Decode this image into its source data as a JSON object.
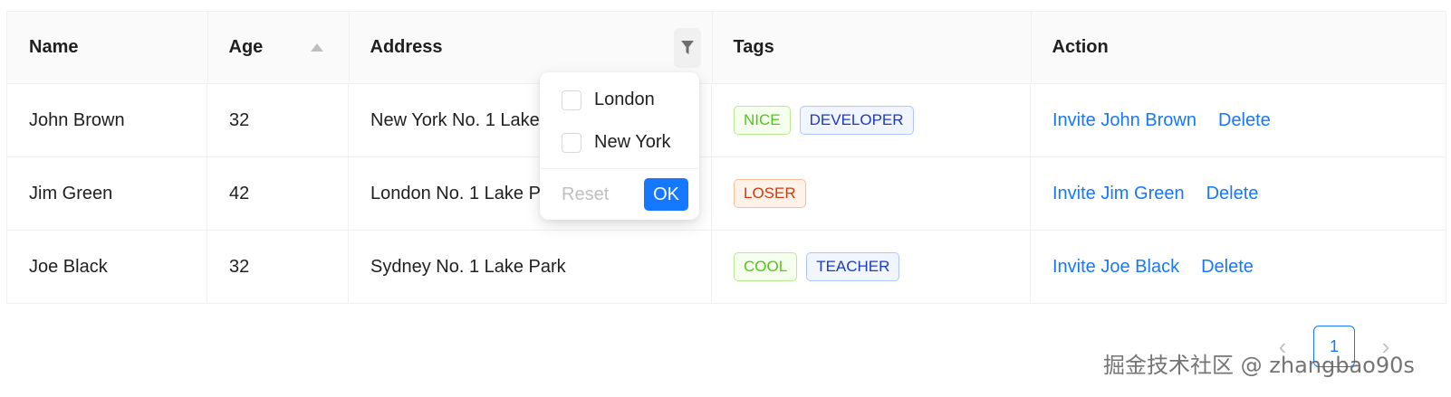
{
  "table": {
    "columns": {
      "name": "Name",
      "age": "Age",
      "address": "Address",
      "tags": "Tags",
      "action": "Action"
    },
    "rows": [
      {
        "name": "John Brown",
        "age": "32",
        "address": "New York No. 1 Lake Park",
        "tags": [
          "NICE",
          "DEVELOPER"
        ],
        "invite": "Invite John Brown",
        "delete": "Delete"
      },
      {
        "name": "Jim Green",
        "age": "42",
        "address": "London No. 1 Lake Park",
        "tags": [
          "LOSER"
        ],
        "invite": "Invite Jim Green",
        "delete": "Delete"
      },
      {
        "name": "Joe Black",
        "age": "32",
        "address": "Sydney No. 1 Lake Park",
        "tags": [
          "COOL",
          "TEACHER"
        ],
        "invite": "Invite Joe Black",
        "delete": "Delete"
      }
    ]
  },
  "filter_dropdown": {
    "options": [
      "London",
      "New York"
    ],
    "reset_label": "Reset",
    "ok_label": "OK"
  },
  "pagination": {
    "current_page": "1",
    "prev_icon": "chevron-left-icon",
    "next_icon": "chevron-right-icon"
  },
  "watermark": "掘金技术社区 @ zhangbao90s",
  "colors": {
    "primary": "#1677ff",
    "header_bg": "#fafafa",
    "tag_green": "#52c41a",
    "tag_blue": "#1d39c4",
    "tag_volcano": "#d4380d"
  }
}
